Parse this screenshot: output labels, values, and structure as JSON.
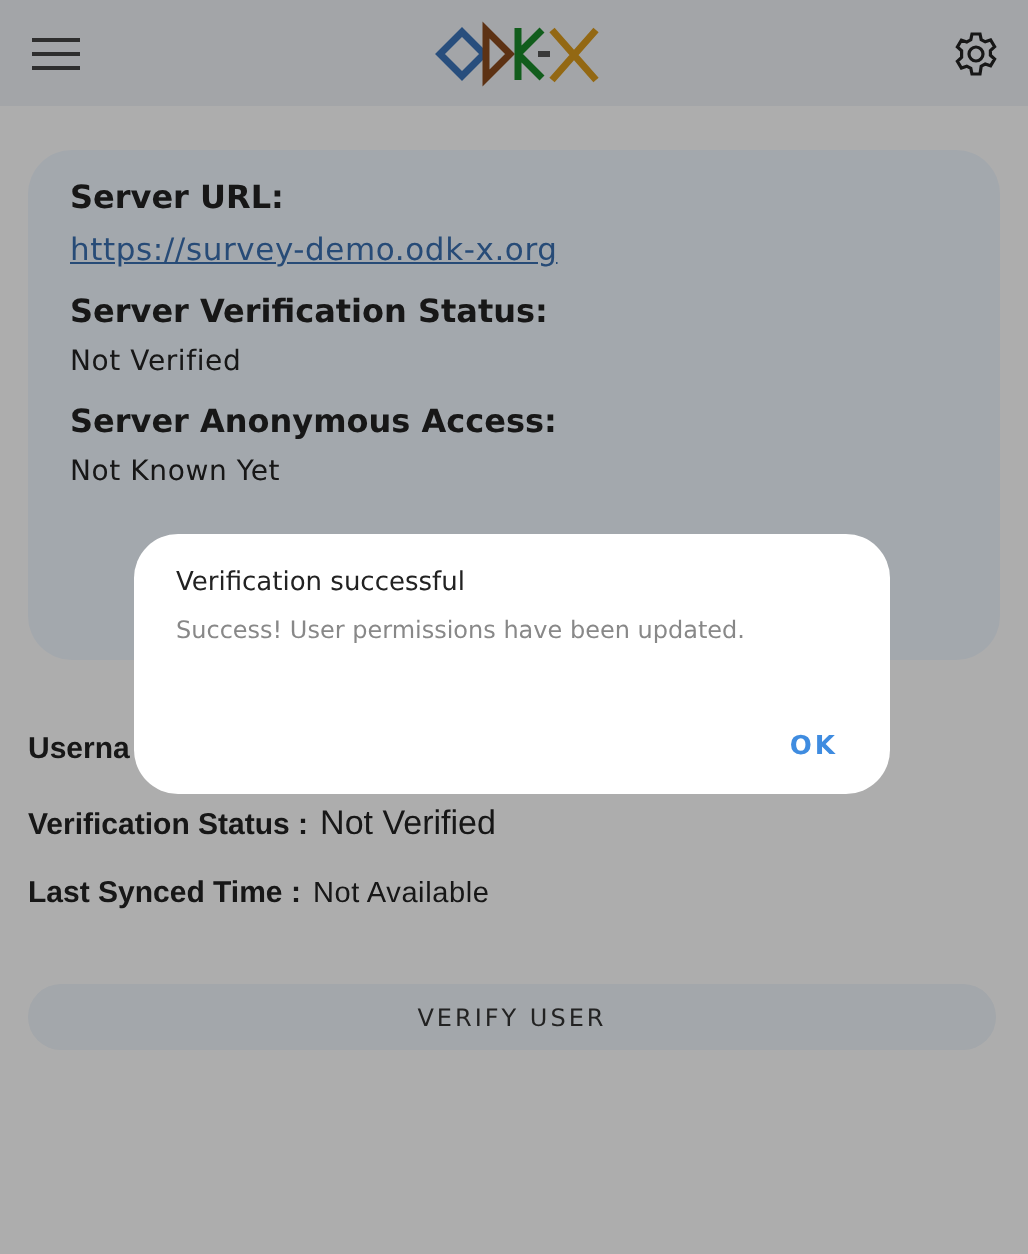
{
  "server": {
    "fields": [
      {
        "label": "Server URL:",
        "value": "https://survey-demo.odk-x.org",
        "kind": "link"
      },
      {
        "label": "Server Verification Status:",
        "value": "Not Verified",
        "kind": "text"
      },
      {
        "label": "Server Anonymous Access:",
        "value": "Not Known Yet",
        "kind": "text"
      }
    ]
  },
  "user": {
    "fields": [
      {
        "label": "Userna"
      },
      {
        "label": "Verification Status :",
        "value": "Not Verified",
        "kind": "large"
      },
      {
        "label": "Last Synced Time :",
        "value": "Not Available",
        "kind": "small"
      }
    ]
  },
  "verify_button": "VERIFY USER",
  "dialog": {
    "title": "Verification successful",
    "message": "Success! User permissions have been updated.",
    "button": "OK"
  }
}
